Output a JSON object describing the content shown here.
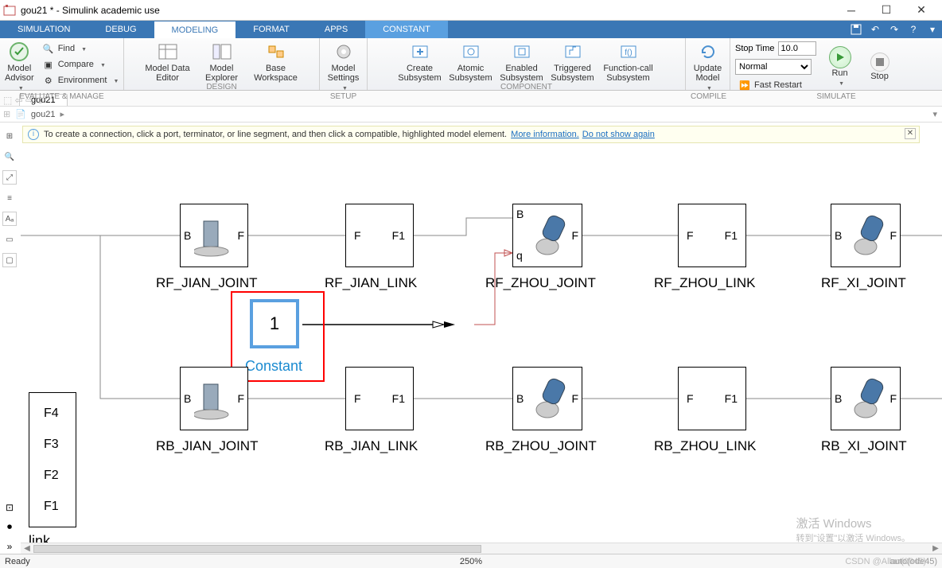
{
  "window": {
    "title": "gou21 * - Simulink academic use"
  },
  "menu": {
    "tabs": [
      "SIMULATION",
      "DEBUG",
      "MODELING",
      "FORMAT",
      "APPS",
      "CONSTANT"
    ],
    "active": 2,
    "high": 5
  },
  "ribbon": {
    "evaluate": {
      "advisor_top": "Model",
      "advisor_bot": "Advisor",
      "find": "Find",
      "compare": "Compare",
      "env": "Environment",
      "label": "EVALUATE & MANAGE"
    },
    "design": {
      "mde_top": "Model Data",
      "mde_bot": "Editor",
      "me_top": "Model",
      "me_bot": "Explorer",
      "bw_top": "Base",
      "bw_bot": "Workspace",
      "label": "DESIGN"
    },
    "setup": {
      "ms_top": "Model",
      "ms_bot": "Settings",
      "label": "SETUP"
    },
    "component": {
      "c1a": "Create",
      "c1b": "Subsystem",
      "c2a": "Atomic",
      "c2b": "Subsystem",
      "c3a": "Enabled",
      "c3b": "Subsystem",
      "c4a": "Triggered",
      "c4b": "Subsystem",
      "c5a": "Function-call",
      "c5b": "Subsystem",
      "label": "COMPONENT"
    },
    "compile": {
      "um_top": "Update",
      "um_bot": "Model",
      "label": "COMPILE"
    },
    "simulate": {
      "stop_label": "Stop Time",
      "stop_val": "10.0",
      "mode": "Normal",
      "fast": "Fast Restart",
      "run": "Run",
      "stop": "Stop",
      "label": "SIMULATE"
    }
  },
  "doc": {
    "tab": "gou21",
    "bc": "gou21"
  },
  "banner": {
    "text": "To create a connection, click a port, terminator, or line segment, and then click a compatible, highlighted model element.",
    "link1": "More information.",
    "link2": "Do not show again"
  },
  "blocks": {
    "rf_jian_joint": "RF_JIAN_JOINT",
    "rf_jian_link": "RF_JIAN_LINK",
    "rf_zhou_joint": "RF_ZHOU_JOINT",
    "rf_zhou_link": "RF_ZHOU_LINK",
    "rf_xi_joint": "RF_XI_JOINT",
    "rb_jian_joint": "RB_JIAN_JOINT",
    "rb_jian_link": "RB_JIAN_LINK",
    "rb_zhou_joint": "RB_ZHOU_JOINT",
    "rb_zhou_link": "RB_ZHOU_LINK",
    "rb_xi_joint": "RB_XI_JOINT",
    "constant_val": "1",
    "constant_label": "Constant",
    "F": "F",
    "F1": "F1",
    "B": "B",
    "q": "q",
    "side": {
      "f4": "F4",
      "f3": "F3",
      "f2": "F2",
      "f1": "F1"
    },
    "link": "link"
  },
  "status": {
    "ready": "Ready",
    "zoom": "250%",
    "right": "auto(ode45)"
  },
  "watermark": {
    "l1": "激活 Windows",
    "l2": "转到\"设置\"以激活 Windows。"
  },
  "csdn": "CSDN @Allao(0645)"
}
